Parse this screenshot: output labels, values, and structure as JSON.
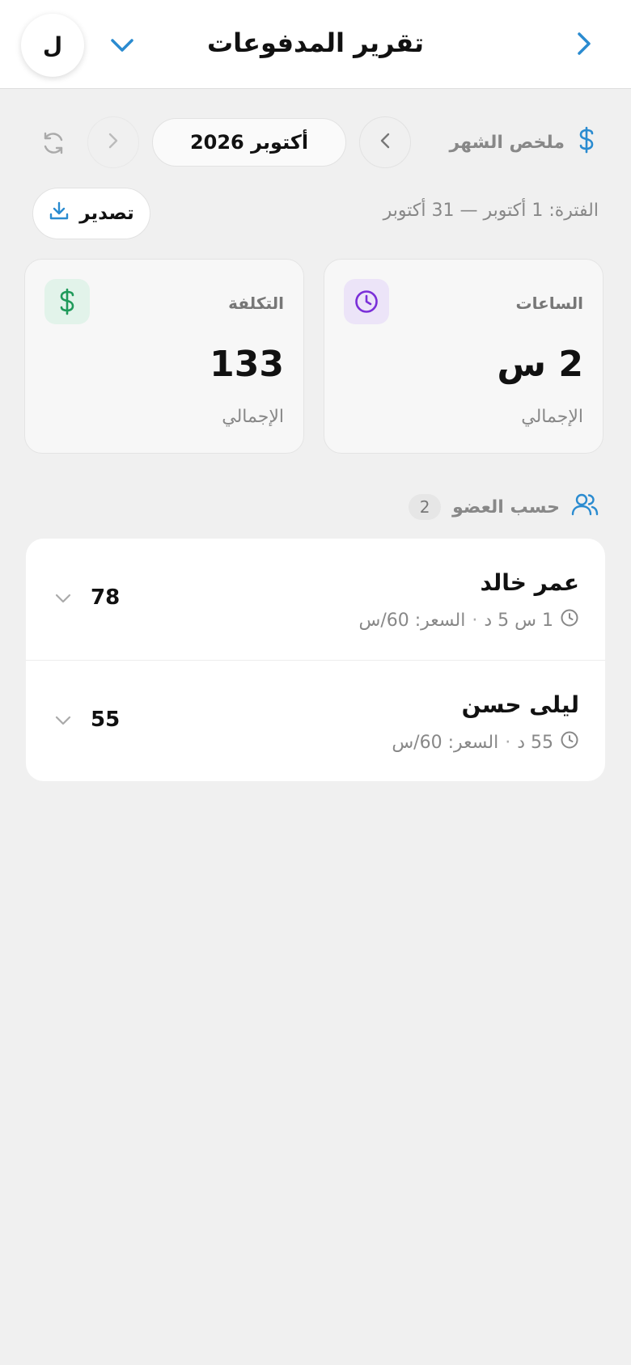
{
  "header": {
    "title": "تقرير المدفوعات",
    "avatar_letter": "ل"
  },
  "summary": {
    "title": "ملخص الشهر",
    "month": "أكتوبر 2026",
    "period": "الفترة: 1 أكتوبر — 31 أكتوبر",
    "export_label": "تصدير"
  },
  "cards": {
    "hours": {
      "label": "الساعات",
      "value": "2 س",
      "sub": "الإجمالي"
    },
    "cost": {
      "label": "التكلفة",
      "value": "133",
      "sub": "الإجمالي"
    }
  },
  "members": {
    "title": "حسب العضو",
    "count": "2",
    "items": [
      {
        "name": "عمر خالد",
        "duration": "1 س 5 د",
        "separator": "·",
        "rate": "السعر: 60/س",
        "amount": "78"
      },
      {
        "name": "ليلى حسن",
        "duration": "55 د",
        "separator": "·",
        "rate": "السعر: 60/س",
        "amount": "55"
      }
    ]
  },
  "colors": {
    "accent": "#2a8bd0",
    "purple": "#7a2fd8",
    "green": "#1f9a5a"
  }
}
